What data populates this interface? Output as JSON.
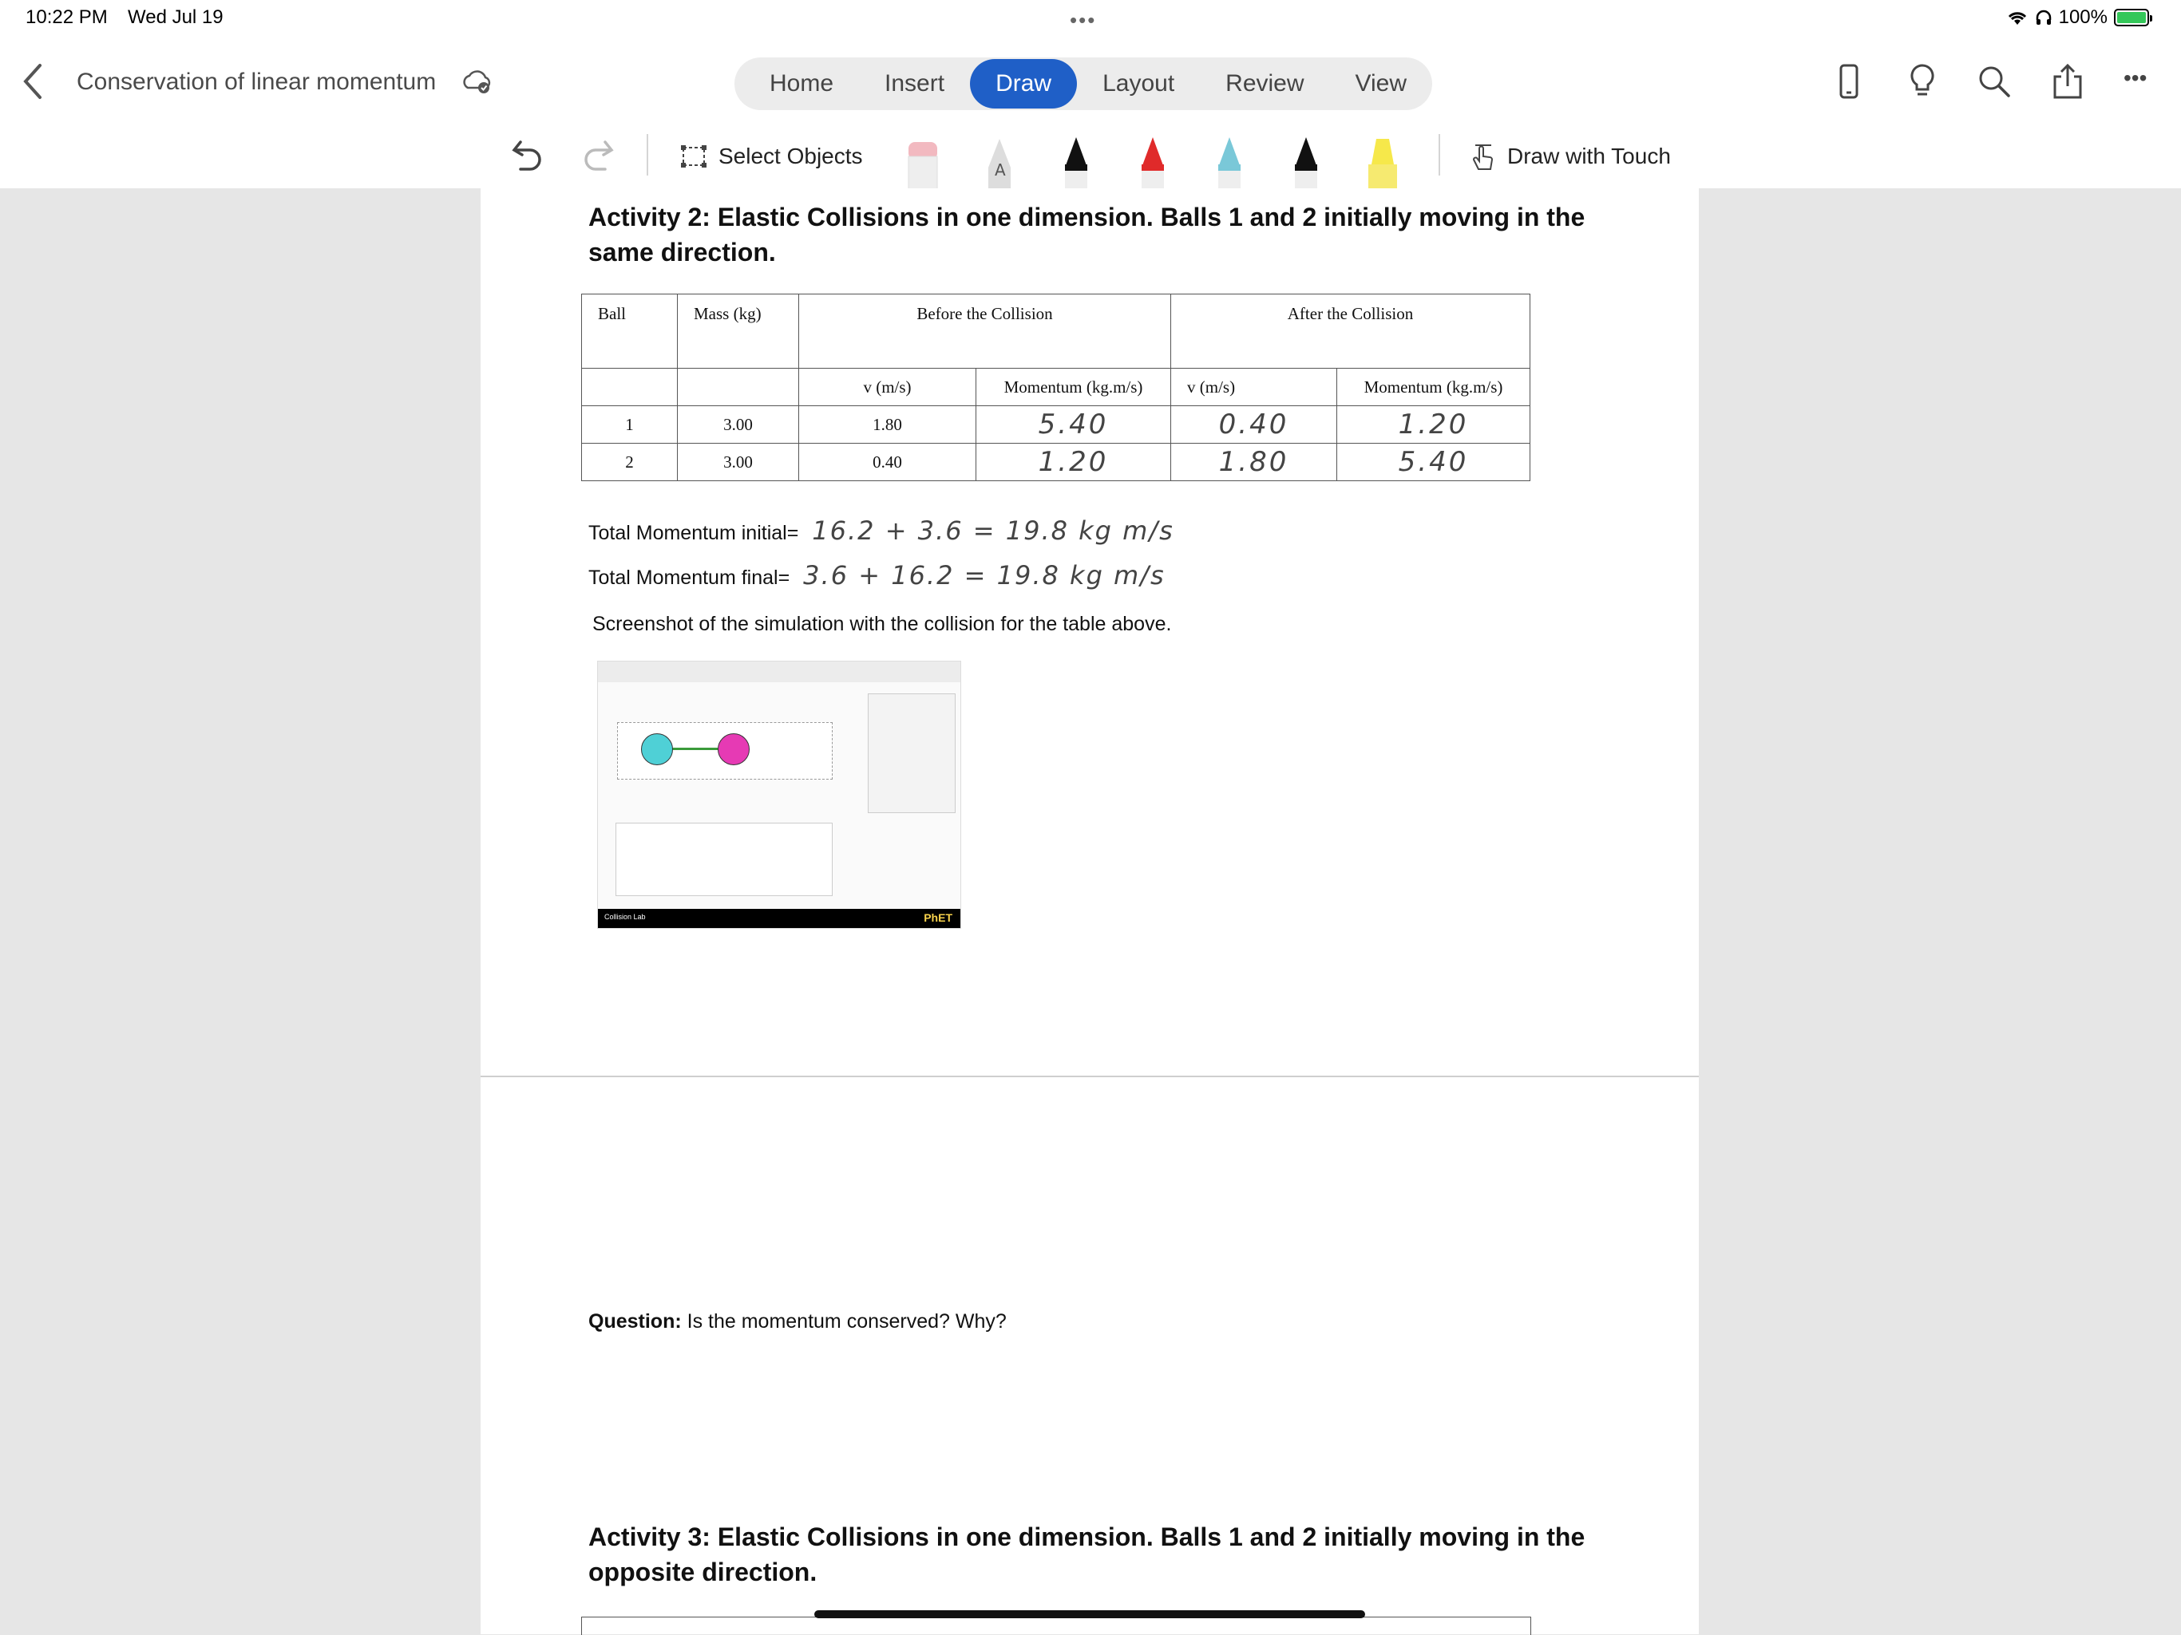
{
  "status_bar": {
    "time": "10:22 PM",
    "date": "Wed Jul 19",
    "dots": "•••",
    "battery_percent": "100%"
  },
  "titlebar": {
    "document_title": "Conservation of linear momentum",
    "tabs": [
      {
        "label": "Home",
        "active": false
      },
      {
        "label": "Insert",
        "active": false
      },
      {
        "label": "Draw",
        "active": true
      },
      {
        "label": "Layout",
        "active": false
      },
      {
        "label": "Review",
        "active": false
      },
      {
        "label": "View",
        "active": false
      }
    ],
    "more_label": "•••"
  },
  "toolbar": {
    "select_objects_label": "Select Objects",
    "draw_with_touch_label": "Draw with Touch",
    "pen_colors": [
      "#f2b9c0",
      "#9a9a9a",
      "#111111",
      "#e02a2a",
      "#7ac8d8",
      "#111111",
      "#f6e84a"
    ]
  },
  "document": {
    "activity2_heading": "Activity 2: Elastic Collisions in one dimension. Balls 1 and 2 initially moving in the same direction.",
    "table": {
      "header": {
        "ball": "Ball",
        "mass": "Mass (kg)",
        "before": "Before the Collision",
        "after": "After the Collision"
      },
      "subheader": {
        "v_before": "v (m/s)",
        "p_before": "Momentum (kg.m/s)",
        "v_after": "v (m/s)",
        "p_after": "Momentum (kg.m/s)"
      },
      "rows": [
        {
          "ball": "1",
          "mass": "3.00",
          "v_before": "1.80",
          "p_before": "5.40",
          "v_after": "0.40",
          "p_after": "1.20"
        },
        {
          "ball": "2",
          "mass": "3.00",
          "v_before": "0.40",
          "p_before": "1.20",
          "v_after": "1.80",
          "p_after": "5.40"
        }
      ]
    },
    "total_initial_label": "Total Momentum initial=",
    "total_initial_value": "16.2 + 3.6 = 19.8 kg m/s",
    "total_final_label": "Total Momentum final=",
    "total_final_value": "3.6 + 16.2 = 19.8 kg m/s",
    "screenshot_caption": "Screenshot of the simulation with the collision for the table above.",
    "sim": {
      "app_name": "Collision Lab",
      "brand": "PhET"
    },
    "question_label": "Question:",
    "question_text": " Is the momentum conserved? Why?",
    "activity3_heading": "Activity 3: Elastic Collisions in one dimension. Balls 1 and 2 initially moving in the opposite direction."
  }
}
